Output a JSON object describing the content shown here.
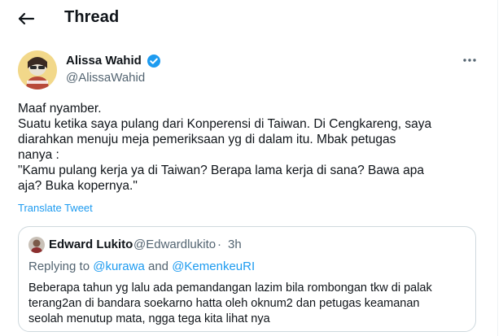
{
  "header": {
    "title": "Thread"
  },
  "tweet": {
    "author_name": "Alissa Wahid",
    "author_handle": "@AlissaWahid",
    "lines": [
      "Maaf nyamber.",
      "Suatu ketika saya pulang dari Konperensi di Taiwan. Di Cengkareng, saya",
      "diarahkan menuju meja pemeriksaan yg di dalam itu. Mbak petugas",
      "nanya :",
      "\"Kamu pulang kerja ya di Taiwan? Berapa lama kerja di sana? Bawa apa",
      "aja? Buka kopernya.\""
    ],
    "translate_label": "Translate Tweet"
  },
  "quote": {
    "author_name": "Edward Lukito",
    "author_handle": "@Edwardlukito",
    "separator": "·",
    "time": "3h",
    "replying_prefix": "Replying to ",
    "replying_to_1": "@kurawa",
    "replying_and": " and ",
    "replying_to_2": "@KemenkeuRI",
    "lines": [
      "Beberapa tahun yg lalu ada pemandangan lazim bila rombongan tkw di palak",
      "terang2an di bandara soekarno hatta oleh oknum2 dan petugas keamanan",
      "seolah menutup mata, ngga tega kita lihat nya"
    ]
  },
  "colors": {
    "accent": "#1d9bf0",
    "text": "#0f1419",
    "secondary": "#536471",
    "border": "#cfd9de"
  },
  "icons": {
    "back": "back-arrow-icon",
    "verified": "verified-badge-icon",
    "more": "more-horizontal-icon"
  }
}
